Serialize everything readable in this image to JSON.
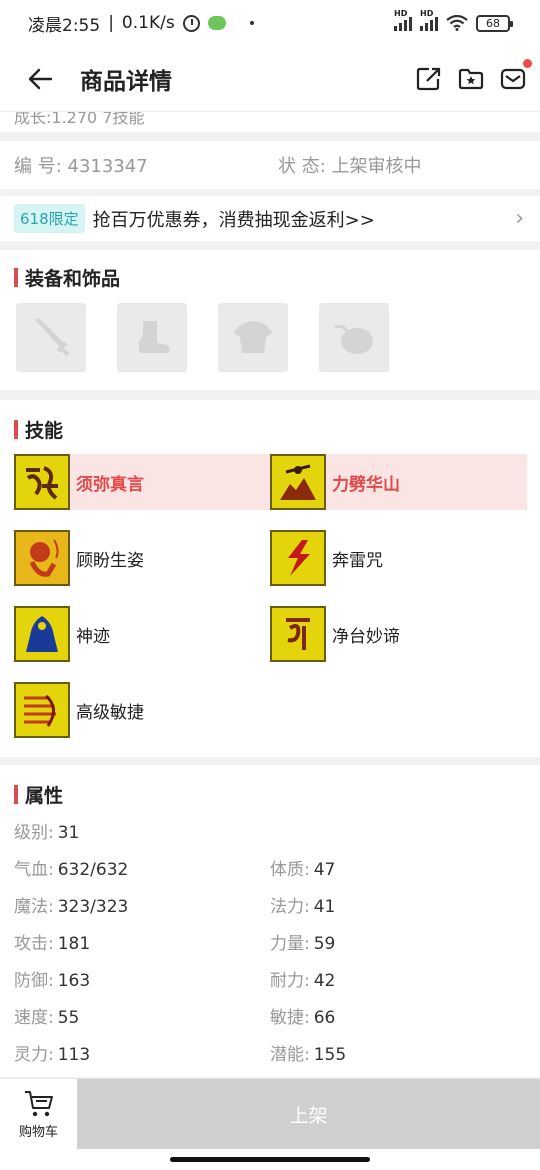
{
  "status_bar": {
    "time": "凌晨2:55",
    "speed": "0.1K/s",
    "battery": "68",
    "net_label": "HD"
  },
  "nav": {
    "title": "商品详情"
  },
  "clipped_text": "成长:1.270 7技能",
  "info": {
    "id_label": "编  号:",
    "id_value": "4313347",
    "status_label": "状  态:",
    "status_value": "上架审核中"
  },
  "promo": {
    "tag": "618限定",
    "text": "抢百万优惠券，消费抽现金返利>>"
  },
  "equipment": {
    "title": "装备和饰品",
    "slots": [
      "weapon",
      "boots",
      "armor",
      "accessory"
    ]
  },
  "skills": {
    "title": "技能",
    "items": [
      {
        "name": "须弥真言",
        "highlight": true,
        "icon": "scroll-rune-icon"
      },
      {
        "name": "力劈华山",
        "highlight": true,
        "icon": "figure-mountain-icon"
      },
      {
        "name": "顾盼生姿",
        "highlight": false,
        "icon": "lion-icon"
      },
      {
        "name": "奔雷咒",
        "highlight": false,
        "icon": "lightning-icon"
      },
      {
        "name": "神迹",
        "highlight": false,
        "icon": "cloaked-figure-icon"
      },
      {
        "name": "净台妙谛",
        "highlight": false,
        "icon": "rune-icon"
      },
      {
        "name": "高级敏捷",
        "highlight": false,
        "icon": "swift-lines-icon"
      }
    ]
  },
  "attributes": {
    "title": "属性",
    "level": {
      "label": "级别:",
      "value": "31"
    },
    "left": [
      {
        "label": "气血:",
        "value": "632/632"
      },
      {
        "label": "魔法:",
        "value": "323/323"
      },
      {
        "label": "攻击:",
        "value": "181"
      },
      {
        "label": "防御:",
        "value": "163"
      },
      {
        "label": "速度:",
        "value": "55"
      },
      {
        "label": "灵力:",
        "value": "113"
      }
    ],
    "right": [
      {
        "label": "体质:",
        "value": "47"
      },
      {
        "label": "法力:",
        "value": "41"
      },
      {
        "label": "力量:",
        "value": "59"
      },
      {
        "label": "耐力:",
        "value": "42"
      },
      {
        "label": "敏捷:",
        "value": "66"
      },
      {
        "label": "潜能:",
        "value": "155"
      }
    ]
  },
  "bottom": {
    "cart_label": "购物车",
    "shelf_label": "上架"
  },
  "colors": {
    "accent": "#e04a4a",
    "promo_tag_bg": "#d7f4f5",
    "promo_tag_text": "#2aa5ad",
    "skill_highlight_bg": "#fae4e4",
    "shelf_button_bg": "#cfcfcf"
  }
}
